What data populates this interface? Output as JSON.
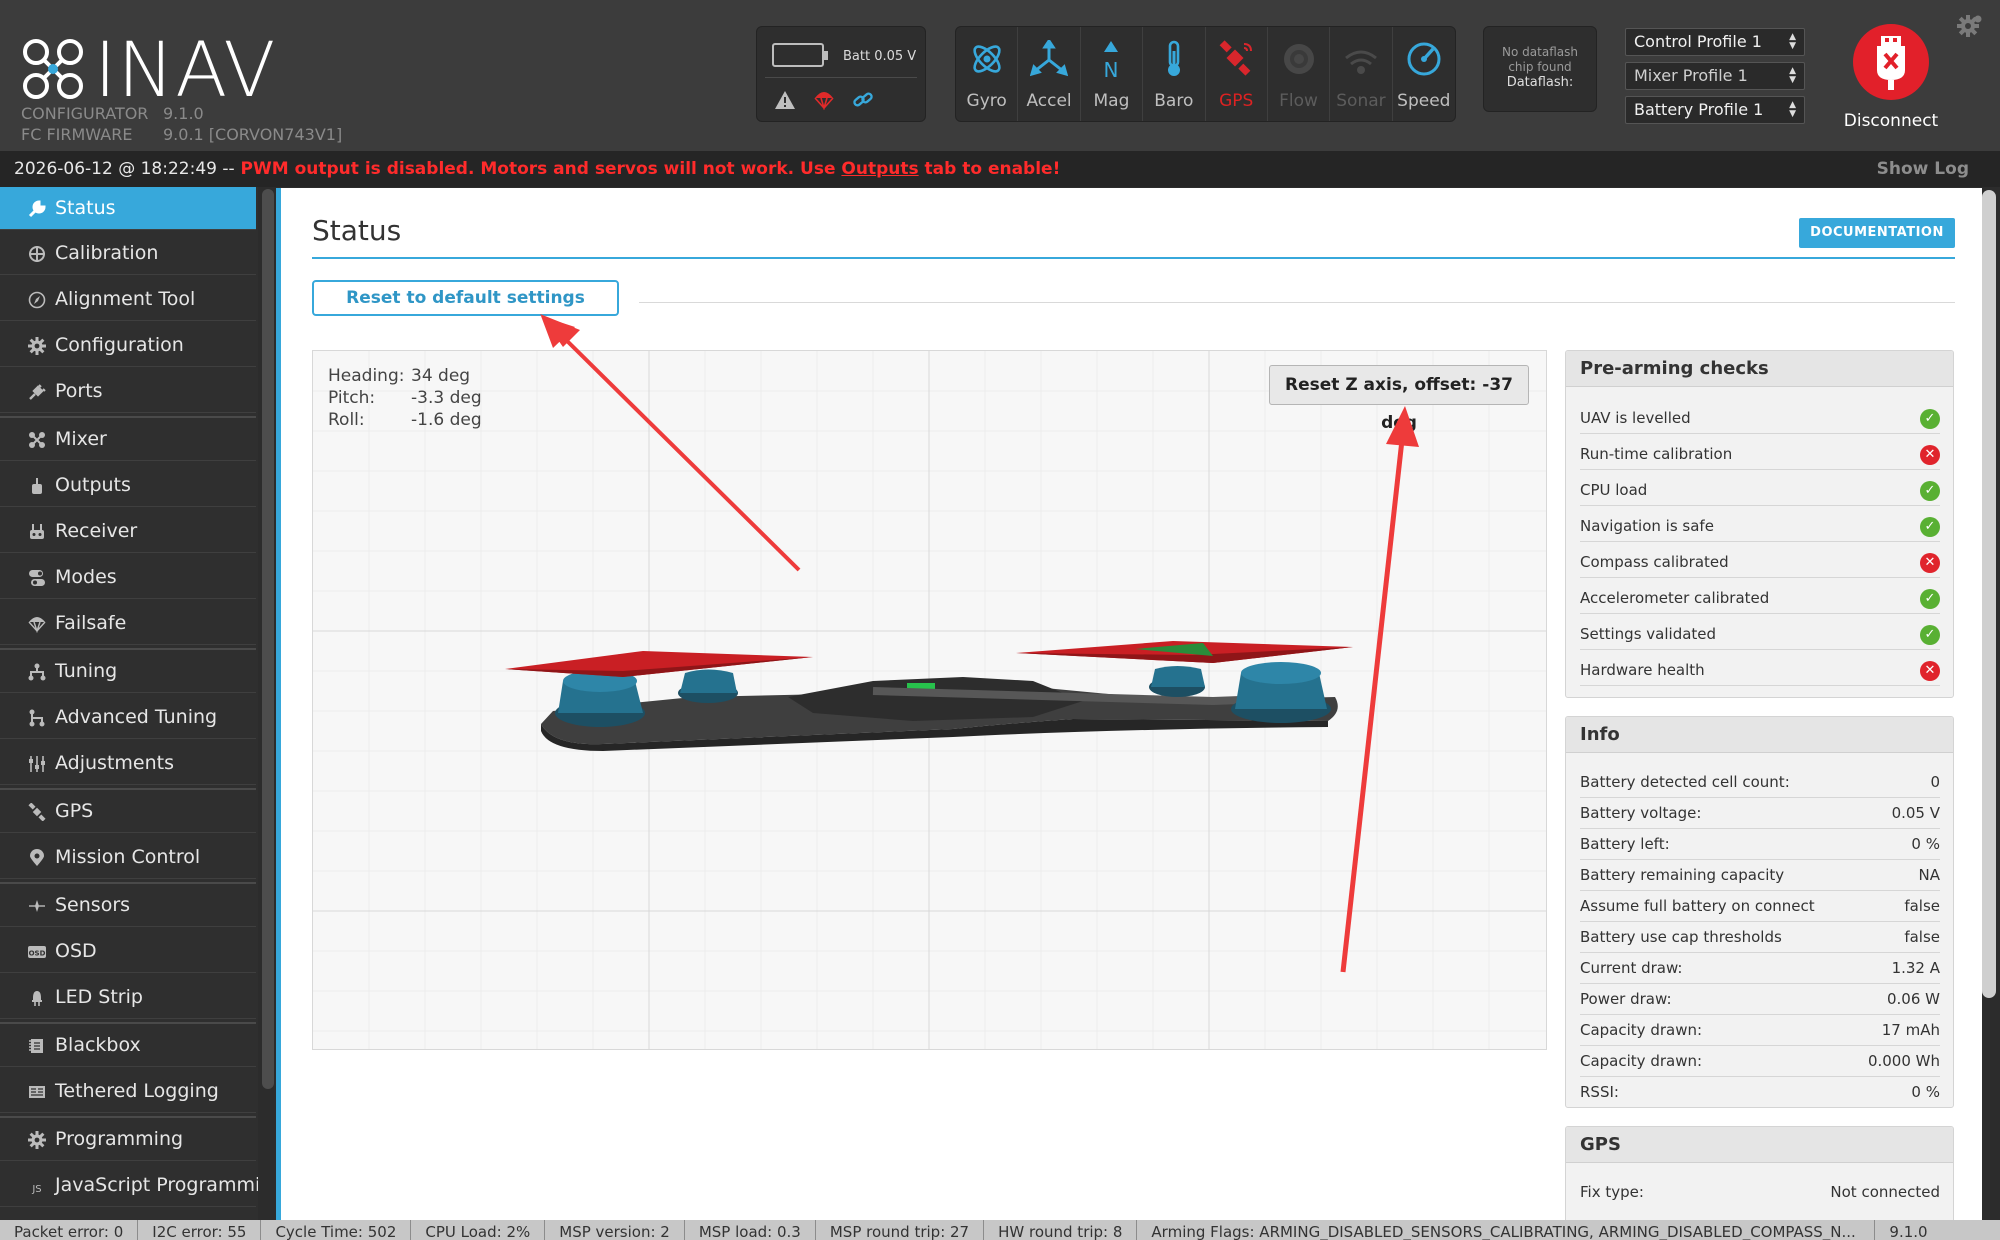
{
  "app": {
    "name": "INAV",
    "configurator_label": "CONFIGURATOR",
    "configurator_version": "9.1.0",
    "firmware_label": "FC FIRMWARE",
    "firmware_version": "9.0.1 [CORVON743V1]"
  },
  "battery": {
    "label": "Batt 0.05 V"
  },
  "sensors": [
    {
      "label": "Gyro",
      "icon": "gyro-icon",
      "state": "active"
    },
    {
      "label": "Accel",
      "icon": "accel-icon",
      "state": "active"
    },
    {
      "label": "Mag",
      "icon": "mag-icon",
      "state": "active"
    },
    {
      "label": "Baro",
      "icon": "baro-icon",
      "state": "active"
    },
    {
      "label": "GPS",
      "icon": "gps-icon",
      "state": "error"
    },
    {
      "label": "Flow",
      "icon": "flow-icon",
      "state": "inactive"
    },
    {
      "label": "Sonar",
      "icon": "sonar-icon",
      "state": "inactive"
    },
    {
      "label": "Speed",
      "icon": "speed-icon",
      "state": "active"
    }
  ],
  "dataflash": {
    "line1": "No dataflash",
    "line2": "chip found",
    "line3": "Dataflash:"
  },
  "profiles": {
    "control": "Control Profile 1",
    "mixer": "Mixer Profile 1",
    "battery": "Battery Profile 1"
  },
  "disconnect": {
    "label": "Disconnect"
  },
  "log": {
    "timestamp": "2026-06-12 @ 18:22:49 --",
    "msg_before": " PWM output is disabled. Motors and servos will not work. Use ",
    "msg_link": "Outputs",
    "msg_after": " tab to enable!",
    "show_log": "Show Log"
  },
  "sidebar": {
    "items": [
      {
        "label": "Status",
        "icon": "wrench-icon",
        "active": true
      },
      {
        "label": "Calibration",
        "icon": "crosshair-icon"
      },
      {
        "label": "Alignment Tool",
        "icon": "compass-icon"
      },
      {
        "label": "Configuration",
        "icon": "gear-icon"
      },
      {
        "label": "Ports",
        "icon": "plug-icon"
      },
      {
        "label": "Mixer",
        "icon": "mixer-icon"
      },
      {
        "label": "Outputs",
        "icon": "motor-icon"
      },
      {
        "label": "Receiver",
        "icon": "receiver-icon"
      },
      {
        "label": "Modes",
        "icon": "toggle-icon"
      },
      {
        "label": "Failsafe",
        "icon": "parachute-icon"
      },
      {
        "label": "Tuning",
        "icon": "tuning-icon"
      },
      {
        "label": "Advanced Tuning",
        "icon": "advanced-tuning-icon"
      },
      {
        "label": "Adjustments",
        "icon": "sliders-icon"
      },
      {
        "label": "GPS",
        "icon": "satellite-icon"
      },
      {
        "label": "Mission Control",
        "icon": "map-pin-icon"
      },
      {
        "label": "Sensors",
        "icon": "sensors-icon"
      },
      {
        "label": "OSD",
        "icon": "osd-icon"
      },
      {
        "label": "LED Strip",
        "icon": "led-icon"
      },
      {
        "label": "Blackbox",
        "icon": "blackbox-icon"
      },
      {
        "label": "Tethered Logging",
        "icon": "tethered-icon"
      },
      {
        "label": "Programming",
        "icon": "programming-gear-icon"
      },
      {
        "label": "JavaScript Programming",
        "icon": "js-icon"
      }
    ]
  },
  "main": {
    "title": "Status",
    "doc_button": "DOCUMENTATION",
    "reset_button": "Reset to default settings",
    "attitude": {
      "heading_label": "Heading:",
      "heading_value": "34 deg",
      "pitch_label": "Pitch:",
      "pitch_value": "-3.3 deg",
      "roll_label": "Roll:",
      "roll_value": "-1.6 deg"
    },
    "reset_z_button": "Reset Z axis, offset: -37 deg"
  },
  "prearm": {
    "title": "Pre-arming checks",
    "checks": [
      {
        "label": "UAV is levelled",
        "ok": true
      },
      {
        "label": "Run-time calibration",
        "ok": false
      },
      {
        "label": "CPU load",
        "ok": true
      },
      {
        "label": "Navigation is safe",
        "ok": true
      },
      {
        "label": "Compass calibrated",
        "ok": false
      },
      {
        "label": "Accelerometer calibrated",
        "ok": true
      },
      {
        "label": "Settings validated",
        "ok": true
      },
      {
        "label": "Hardware health",
        "ok": false
      }
    ]
  },
  "info": {
    "title": "Info",
    "rows": [
      {
        "label": "Battery detected cell count:",
        "value": "0"
      },
      {
        "label": "Battery voltage:",
        "value": "0.05 V"
      },
      {
        "label": "Battery left:",
        "value": "0 %"
      },
      {
        "label": "Battery remaining capacity",
        "value": "NA"
      },
      {
        "label": "Assume full battery on connect",
        "value": "false"
      },
      {
        "label": "Battery use cap thresholds",
        "value": "false"
      },
      {
        "label": "Current draw:",
        "value": "1.32 A"
      },
      {
        "label": "Power draw:",
        "value": "0.06 W"
      },
      {
        "label": "Capacity drawn:",
        "value": "17 mAh"
      },
      {
        "label": "Capacity drawn:",
        "value": "0.000 Wh"
      },
      {
        "label": "RSSI:",
        "value": "0 %"
      }
    ]
  },
  "gps": {
    "title": "GPS",
    "fix_label": "Fix type:",
    "fix_value": "Not connected"
  },
  "statusbar": {
    "packet_error": "Packet error: 0",
    "i2c_error": "I2C error: 55",
    "cycle_time": "Cycle Time: 502",
    "cpu_load": "CPU Load: 2%",
    "msp_version": "MSP version: 2",
    "msp_load": "MSP load: 0.3",
    "msp_round_trip": "MSP round trip: 27",
    "hw_round_trip": "HW round trip: 8",
    "arming_flags": "Arming Flags: ARMING_DISABLED_SENSORS_CALIBRATING, ARMING_DISABLED_COMPASS_N...",
    "version": "9.1.0"
  },
  "colors": {
    "accent": "#37a8db",
    "error": "#e0242c",
    "ok": "#59b033",
    "log_warning": "#ff2b2b",
    "annotation_arrow": "#ee3b3b"
  }
}
